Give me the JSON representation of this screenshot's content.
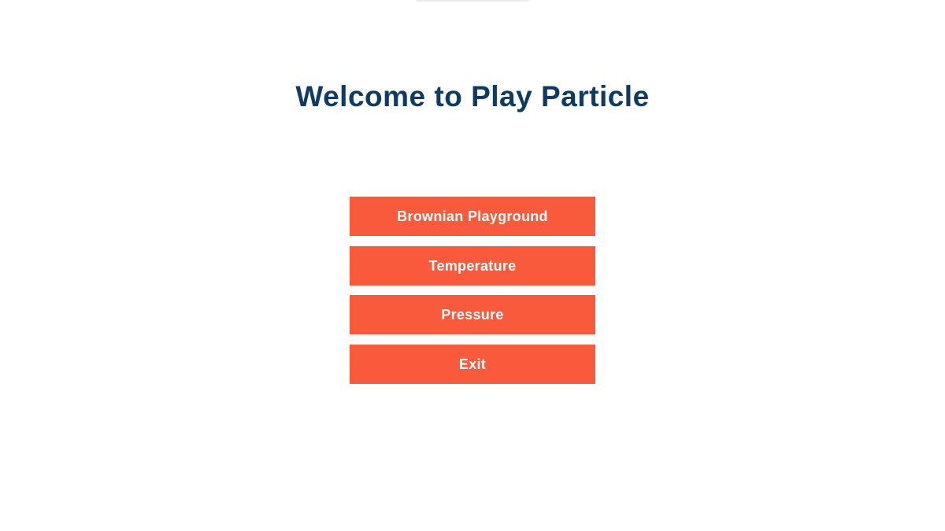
{
  "welcome": {
    "title": "Welcome to Play Particle"
  },
  "menu": {
    "items": [
      {
        "label": "Brownian Playground"
      },
      {
        "label": "Temperature"
      },
      {
        "label": "Pressure"
      },
      {
        "label": "Exit"
      }
    ]
  },
  "colors": {
    "title": "#0e3a63",
    "button_background": "#fa5a3c",
    "button_text": "#ffffff",
    "page_background": "#ffffff"
  }
}
